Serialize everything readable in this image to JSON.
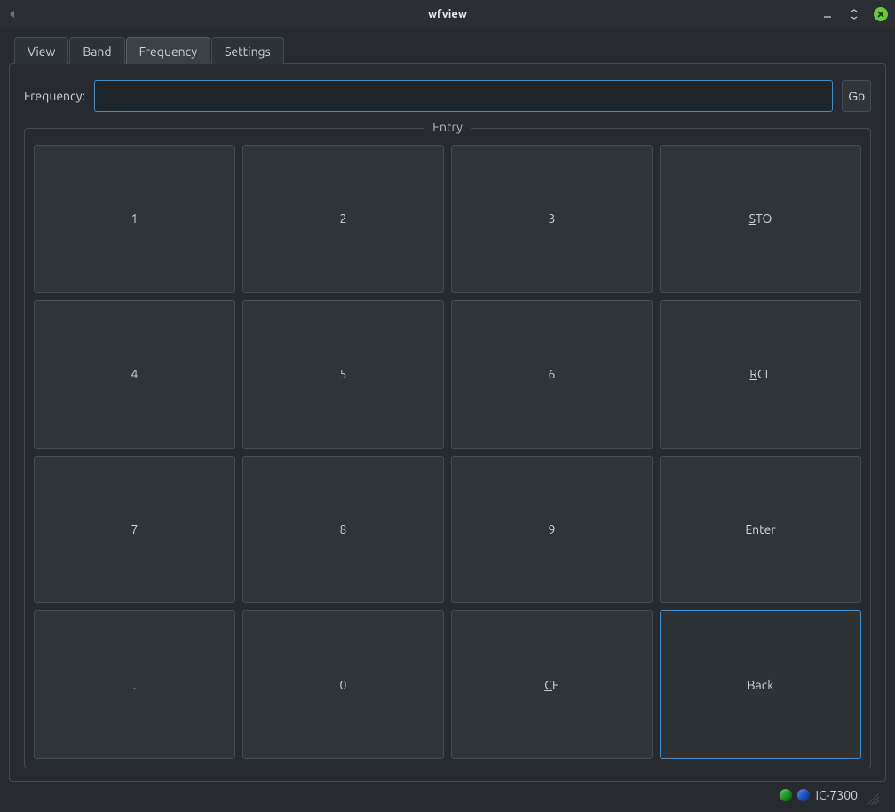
{
  "window": {
    "title": "wfview"
  },
  "tabs": {
    "items": [
      {
        "label": "View"
      },
      {
        "label": "Band"
      },
      {
        "label": "Frequency"
      },
      {
        "label": "Settings"
      }
    ],
    "active_index": 2
  },
  "frequency": {
    "label": "Frequency:",
    "value": "",
    "go_label": "Go"
  },
  "entry": {
    "legend": "Entry",
    "keys": [
      {
        "label": "1"
      },
      {
        "label": "2"
      },
      {
        "label": "3"
      },
      {
        "label": "STO",
        "underline_index": 0
      },
      {
        "label": "4"
      },
      {
        "label": "5"
      },
      {
        "label": "6"
      },
      {
        "label": "RCL",
        "underline_index": 0
      },
      {
        "label": "7"
      },
      {
        "label": "8"
      },
      {
        "label": "9"
      },
      {
        "label": "Enter"
      },
      {
        "label": "."
      },
      {
        "label": "0"
      },
      {
        "label": "CE",
        "underline_index": 0
      },
      {
        "label": "Back",
        "focused": true
      }
    ]
  },
  "status": {
    "indicators": [
      {
        "color": "green"
      },
      {
        "color": "blue"
      }
    ],
    "text": "IC-7300"
  }
}
